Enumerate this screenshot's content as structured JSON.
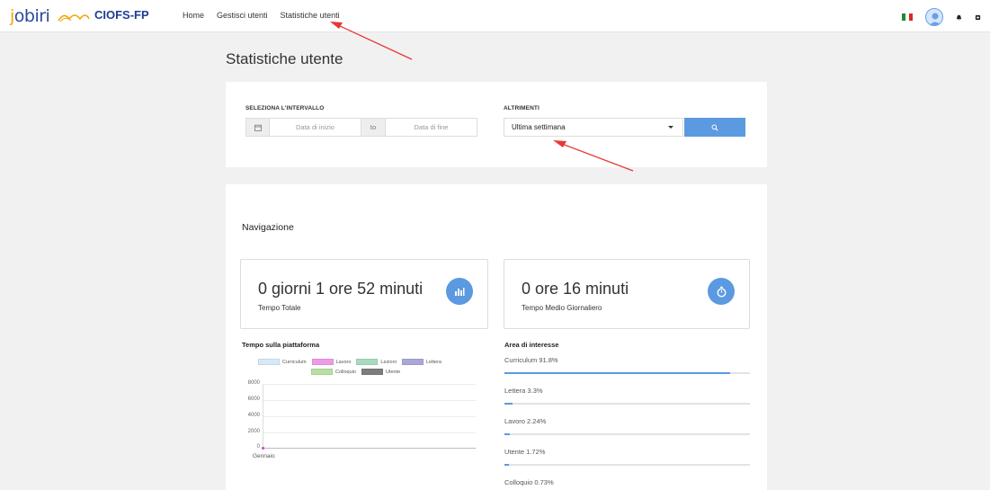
{
  "brand": {
    "jobiri_j": "j",
    "jobiri_rest": "obiri",
    "ciofs": "CIOFS-FP"
  },
  "nav": {
    "links": [
      "Home",
      "Gestisci utenti",
      "Statistiche utenti"
    ]
  },
  "page": {
    "title": "Statistiche utente"
  },
  "filter": {
    "interval_label": "SELEZIONA L'INTERVALLO",
    "start_placeholder": "Data di inizio",
    "to_label": "to",
    "end_placeholder": "Data di fine",
    "alt_label": "ALTRIMENTI",
    "select_value": "Ultima settimana"
  },
  "navigation": {
    "title": "Navigazione",
    "total_value": "0 giorni 1 ore 52 minuti",
    "total_label": "Tempo Totale",
    "avg_value": "0 ore 16 minuti",
    "avg_label": "Tempo Medio Giornaliero"
  },
  "chart_data": {
    "type": "line",
    "title": "Tempo sulla piattaforma",
    "categories": [
      "Gennaio"
    ],
    "series": [
      {
        "name": "Curriculum",
        "values": [
          0
        ],
        "color": "#d7e8f7"
      },
      {
        "name": "Lavoro",
        "values": [
          0
        ],
        "color": "#ef9be6"
      },
      {
        "name": "Lezioni",
        "values": [
          0
        ],
        "color": "#a9dbbe"
      },
      {
        "name": "Lettera",
        "values": [
          0
        ],
        "color": "#a9a8d6"
      },
      {
        "name": "Colloquio",
        "values": [
          0
        ],
        "color": "#b7e0a2"
      },
      {
        "name": "Utente",
        "values": [
          0
        ],
        "color": "#7d7d7d"
      }
    ],
    "ylim": [
      0,
      8000
    ],
    "yticks": [
      "8000",
      "6000",
      "4000",
      "2000",
      "0"
    ]
  },
  "interest": {
    "title": "Area di interesse",
    "items": [
      {
        "label": "Curriculum 91.8%",
        "percent": 91.8
      },
      {
        "label": "Lettera 3.3%",
        "percent": 3.3
      },
      {
        "label": "Lavoro 2.24%",
        "percent": 2.24
      },
      {
        "label": "Utente 1.72%",
        "percent": 1.72
      },
      {
        "label": "Colloquio 0.73%",
        "percent": 0.73
      }
    ]
  },
  "colors": {
    "accent": "#5b9ae0",
    "annotation": "#e53935"
  }
}
